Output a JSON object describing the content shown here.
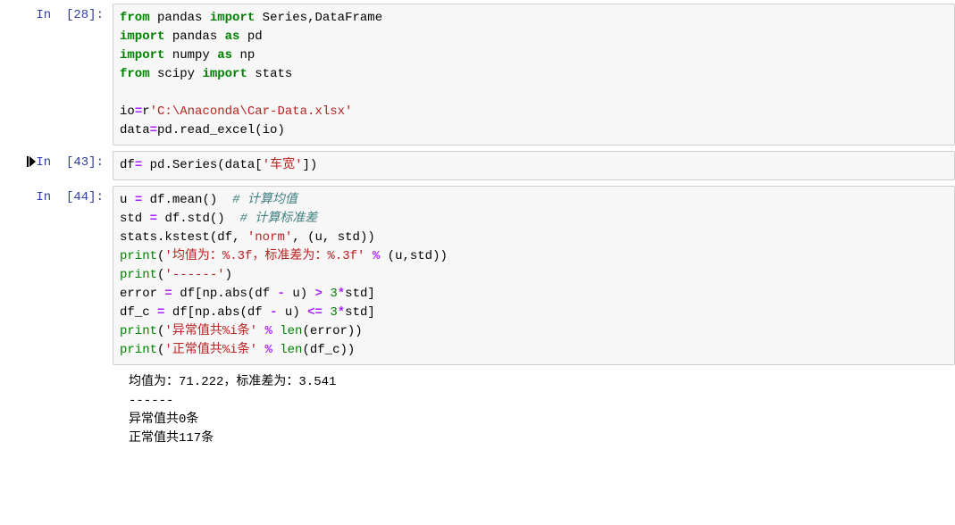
{
  "cells": [
    {
      "prompt": "In  [28]:",
      "has_run_icon": false,
      "code_html": "<span class='kw-green'>from</span> <span class='name'>pandas</span> <span class='kw-green'>import</span> <span class='name'>Series,DataFrame</span>\n<span class='kw-green'>import</span> <span class='name'>pandas</span> <span class='kw-green'>as</span> <span class='name'>pd</span>\n<span class='kw-green'>import</span> <span class='name'>numpy</span> <span class='kw-green'>as</span> <span class='name'>np</span>\n<span class='kw-green'>from</span> <span class='name'>scipy</span> <span class='kw-green'>import</span> <span class='name'>stats</span>\n\n<span class='name'>io</span><span class='kw-op'>=</span><span class='str-prefix'>r</span><span class='str'>'C:\\Anaconda\\Car-Data.xlsx'</span>\n<span class='name'>data</span><span class='kw-op'>=</span><span class='name'>pd</span><span class='punct'>.</span><span class='name'>read_excel</span><span class='punct'>(</span><span class='name'>io</span><span class='punct'>)</span>",
      "output": null
    },
    {
      "prompt": "In  [43]:",
      "has_run_icon": true,
      "code_html": "<span class='name'>df</span><span class='kw-op'>=</span> <span class='name'>pd</span><span class='punct'>.</span><span class='name'>Series</span><span class='punct'>(</span><span class='name'>data</span><span class='punct'>[</span><span class='str'>'车宽'</span><span class='punct'>])</span>",
      "output": null
    },
    {
      "prompt": "In  [44]:",
      "has_run_icon": false,
      "code_html": "<span class='name'>u</span> <span class='kw-op'>=</span> <span class='name'>df</span><span class='punct'>.</span><span class='name'>mean</span><span class='punct'>()</span>  <span class='comment'># 计算均值</span>\n<span class='name'>std</span> <span class='kw-op'>=</span> <span class='name'>df</span><span class='punct'>.</span><span class='name'>std</span><span class='punct'>()</span>  <span class='comment'># 计算标准差</span>\n<span class='name'>stats</span><span class='punct'>.</span><span class='name'>kstest</span><span class='punct'>(</span><span class='name'>df</span><span class='punct'>,</span> <span class='str'>'norm'</span><span class='punct'>,</span> <span class='punct'>(</span><span class='name'>u</span><span class='punct'>,</span> <span class='name'>std</span><span class='punct'>))</span>\n<span class='builtin'>print</span><span class='punct'>(</span><span class='str'>'均值为：%.3f，标准差为：%.3f'</span> <span class='kw-op'>%</span> <span class='punct'>(</span><span class='name'>u</span><span class='punct'>,</span><span class='name'>std</span><span class='punct'>))</span>\n<span class='builtin'>print</span><span class='punct'>(</span><span class='str'>'------'</span><span class='punct'>)</span>\n<span class='name'>error</span> <span class='kw-op'>=</span> <span class='name'>df</span><span class='punct'>[</span><span class='name'>np</span><span class='punct'>.</span><span class='name'>abs</span><span class='punct'>(</span><span class='name'>df</span> <span class='kw-op'>-</span> <span class='name'>u</span><span class='punct'>)</span> <span class='kw-op'>&gt;</span> <span class='num'>3</span><span class='kw-op'>*</span><span class='name'>std</span><span class='punct'>]</span>\n<span class='name'>df_c</span> <span class='kw-op'>=</span> <span class='name'>df</span><span class='punct'>[</span><span class='name'>np</span><span class='punct'>.</span><span class='name'>abs</span><span class='punct'>(</span><span class='name'>df</span> <span class='kw-op'>-</span> <span class='name'>u</span><span class='punct'>)</span> <span class='kw-op'>&lt;=</span> <span class='num'>3</span><span class='kw-op'>*</span><span class='name'>std</span><span class='punct'>]</span>\n<span class='builtin'>print</span><span class='punct'>(</span><span class='str'>'异常值共%i条'</span> <span class='kw-op'>%</span> <span class='builtin'>len</span><span class='punct'>(</span><span class='name'>error</span><span class='punct'>))</span>\n<span class='builtin'>print</span><span class='punct'>(</span><span class='str'>'正常值共%i条'</span> <span class='kw-op'>%</span> <span class='builtin'>len</span><span class='punct'>(</span><span class='name'>df_c</span><span class='punct'>))</span>",
      "output": "均值为：71.222，标准差为：3.541\n------\n异常值共0条\n正常值共117条"
    }
  ]
}
